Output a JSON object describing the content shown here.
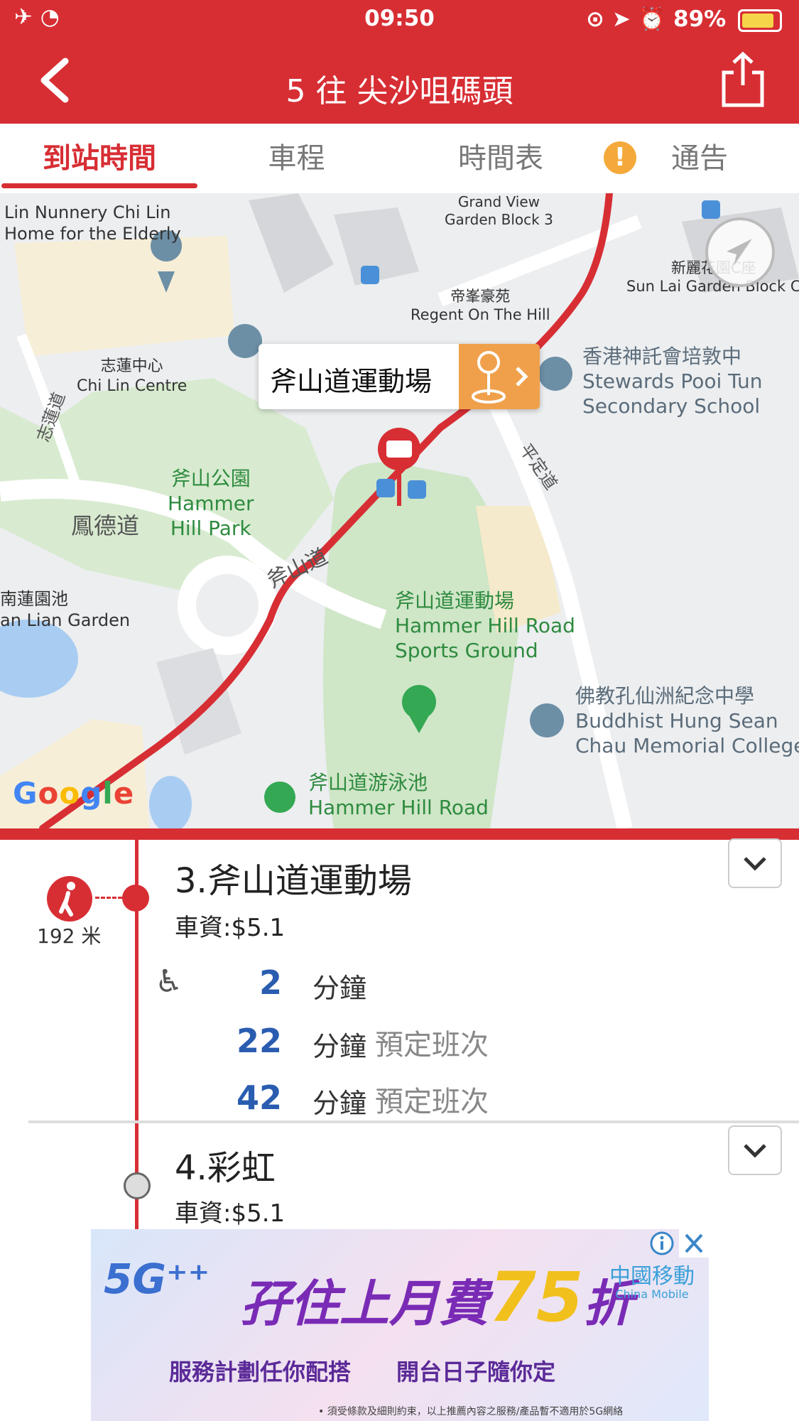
{
  "status_bar": {
    "time": "09:50",
    "battery": "89%"
  },
  "header": {
    "title": "5 往 尖沙咀碼頭",
    "back_icon": "chevron-left-icon",
    "share_icon": "share-icon"
  },
  "tabs": [
    {
      "label": "到站時間",
      "active": true
    },
    {
      "label": "車程",
      "active": false
    },
    {
      "label": "時間表",
      "active": false
    },
    {
      "label": "通告",
      "active": false,
      "icon": "warning-icon"
    }
  ],
  "map": {
    "popup": "斧山道運動場",
    "labels": {
      "nunnery": "Lin Nunnery Chi Lin\nHome for the Elderly",
      "grandview": "Grand View\nGarden Block 3",
      "sunlai": "新麗花園C座\nSun Lai Garden Block C",
      "regent": "帝峯豪苑\nRegent On The Hill",
      "chilin": "志蓮中心\nChi Lin Centre",
      "stewards": "香港神託會培敦中\nStewards Pooi Tun\nSecondary School",
      "park": "斧山公園\nHammer\nHill Park",
      "fungtak": "鳳德道",
      "hammerroad": "斧山道",
      "pingting": "平定道",
      "chilinroad": "志蓮道",
      "nanlian": "南蓮園池\nan Lian Garden",
      "sportsground": "斧山道運動場\nHammer Hill Road\nSports Ground",
      "buddhist": "佛教孔仙洲紀念中學\nBuddhist Hung Sean\nChau Memorial College",
      "pool": "斧山道游泳池\nHammer Hill Road"
    },
    "attribution": "Google"
  },
  "stops": [
    {
      "title": "3.斧山道運動場",
      "fare": "車資:$5.1",
      "walk_distance": "192 米",
      "etas": [
        {
          "minutes": "2",
          "unit": "分鐘",
          "note": ""
        },
        {
          "minutes": "22",
          "unit": "分鐘",
          "note": "預定班次"
        },
        {
          "minutes": "42",
          "unit": "分鐘",
          "note": "預定班次"
        }
      ]
    },
    {
      "title": "4.彩虹",
      "fare": "車資:$5.1"
    }
  ],
  "ad": {
    "fiveg": "5G⁺⁺",
    "headline_prefix": "孖住上月費",
    "headline_number": "75",
    "headline_suffix": "折",
    "brand_cn": "中國移動",
    "brand_en": "China Mobile",
    "features": "服務計劃任你配搭　　開台日子隨你定",
    "fine_print": "• 須受條款及細則約束，以上推薦內容之服務/產品暫不適用於5G網絡"
  },
  "colors": {
    "brand_red": "#d72e34",
    "eta_blue": "#2a5db0",
    "accent_orange": "#f0a04b"
  }
}
